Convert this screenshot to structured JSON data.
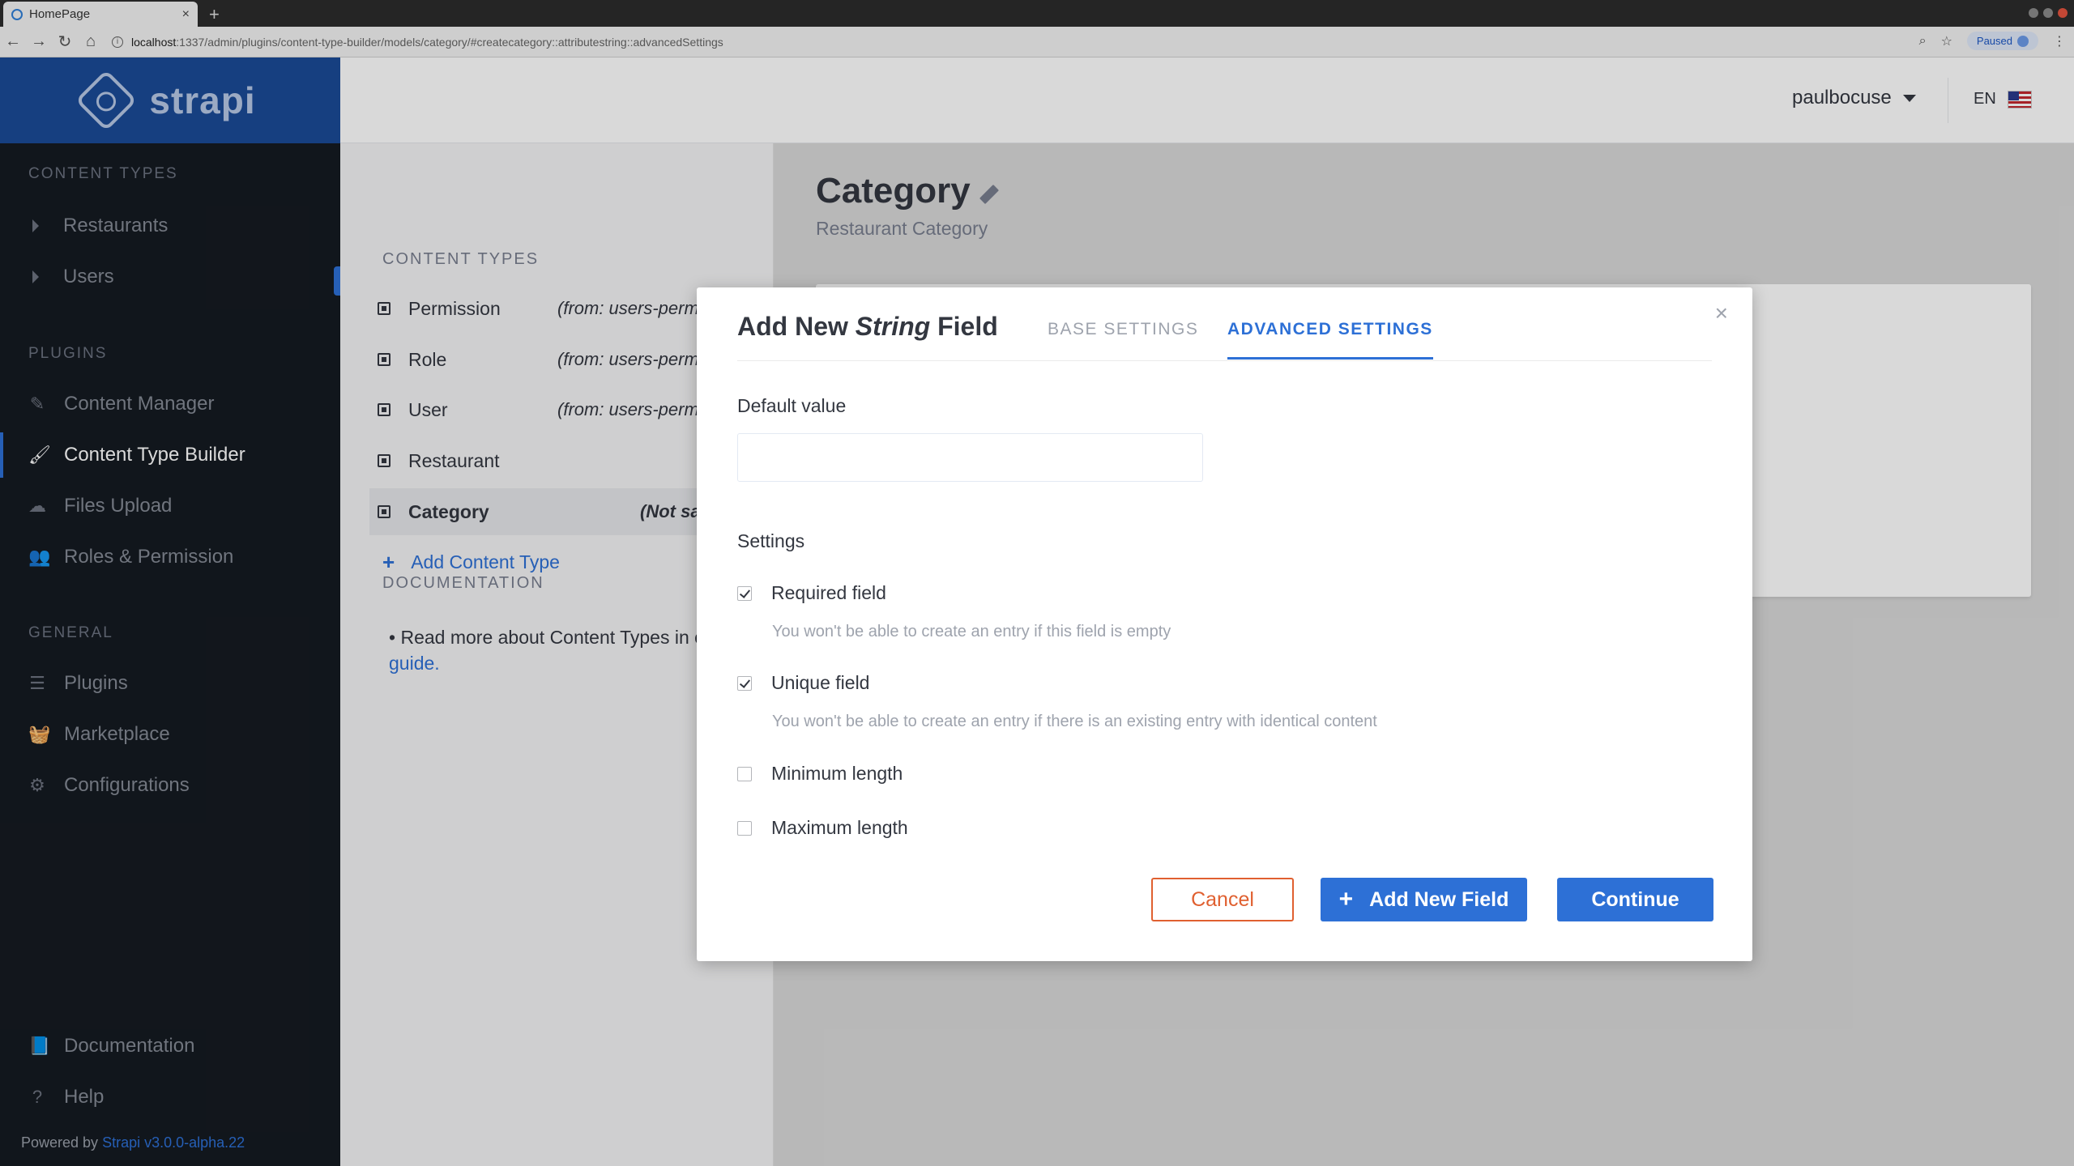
{
  "browser": {
    "tab_title": "HomePage",
    "new_tab": "+",
    "url_host": "localhost",
    "url_path": ":1337/admin/plugins/content-type-builder/models/category/#createcategory::attributestring::advancedSettings",
    "paused_label": "Paused"
  },
  "sidebar": {
    "logo_text": "strapi",
    "content_types_heading": "CONTENT TYPES",
    "content_types": [
      {
        "label": "Restaurants"
      },
      {
        "label": "Users"
      }
    ],
    "plugins_heading": "PLUGINS",
    "plugins": [
      {
        "label": "Content Manager",
        "icon": "pen-icon"
      },
      {
        "label": "Content Type Builder",
        "icon": "brush-icon",
        "active": true
      },
      {
        "label": "Files Upload",
        "icon": "cloud-upload-icon"
      },
      {
        "label": "Roles & Permission",
        "icon": "users-icon"
      }
    ],
    "general_heading": "GENERAL",
    "general": [
      {
        "label": "Plugins",
        "icon": "list-icon"
      },
      {
        "label": "Marketplace",
        "icon": "basket-icon"
      },
      {
        "label": "Configurations",
        "icon": "gear-icon"
      }
    ],
    "footer": [
      {
        "label": "Documentation",
        "icon": "book-icon"
      },
      {
        "label": "Help",
        "icon": "question-icon"
      }
    ],
    "powered_by": "Powered by",
    "powered_link": "Strapi v3.0.0-alpha.22"
  },
  "topbar": {
    "username": "paulbocuse",
    "language": "EN"
  },
  "ct_panel": {
    "heading": "CONTENT TYPES",
    "items": [
      {
        "label": "Permission",
        "from": "(from: users-permissions)"
      },
      {
        "label": "Role",
        "from": "(from: users-permissi"
      },
      {
        "label": "User",
        "from": "(from: users-permissi"
      },
      {
        "label": "Restaurant",
        "from": ""
      },
      {
        "label": "Category",
        "from": "(Not save"
      }
    ],
    "add_label": "Add Content Type",
    "doc_heading": "DOCUMENTATION",
    "doc_text": "Read more about Content Types in our",
    "doc_link": "guide."
  },
  "main": {
    "title": "Category",
    "subtitle": "Restaurant Category"
  },
  "modal": {
    "title_prefix": "Add New",
    "title_type": "String",
    "title_suffix": "Field",
    "tab_base": "BASE SETTINGS",
    "tab_advanced": "ADVANCED SETTINGS",
    "close": "×",
    "default_value_label": "Default value",
    "default_value": "",
    "settings_label": "Settings",
    "required_label": "Required field",
    "required_desc": "You won't be able to create an entry if this field is empty",
    "required_checked": true,
    "unique_label": "Unique field",
    "unique_desc": "You won't be able to create an entry if there is an existing entry with identical content",
    "unique_checked": true,
    "min_label": "Minimum length",
    "max_label": "Maximum length",
    "cancel": "Cancel",
    "add_new": "Add New Field",
    "continue": "Continue"
  }
}
